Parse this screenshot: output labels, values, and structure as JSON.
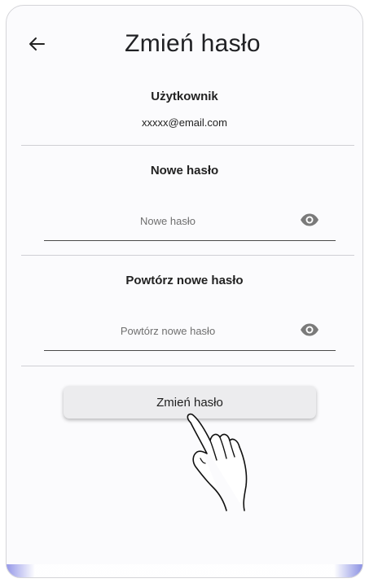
{
  "header": {
    "title": "Zmień hasło",
    "back_icon": "arrow-left-icon"
  },
  "user_section": {
    "label": "Użytkownik",
    "email": "xxxxx@email.com"
  },
  "new_password": {
    "label": "Nowe hasło",
    "placeholder": "Nowe hasło",
    "value": "",
    "icon": "eye-icon"
  },
  "repeat_password": {
    "label": "Powtórz nowe hasło",
    "placeholder": "Powtórz nowe hasło",
    "value": "",
    "icon": "eye-icon"
  },
  "submit": {
    "label": "Zmień hasło"
  },
  "overlay": {
    "icon": "hand-pointer-icon"
  },
  "colors": {
    "background": "#fbfbfd",
    "button": "#ececee",
    "divider": "#cfcfd4",
    "accent_edge": "#8a8de6"
  }
}
